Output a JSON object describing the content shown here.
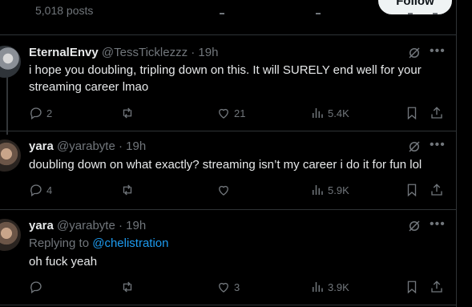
{
  "header": {
    "posts_count": "5,018 posts",
    "follow_label": "Follow"
  },
  "tweets": [
    {
      "name": "EternalEnvy",
      "handle": "@TessTicklezzz",
      "sep": "·",
      "time": "19h",
      "text": "i hope you doubling, tripling down on this. It will SURELY end well for your streaming career lmao",
      "replies": "2",
      "reposts": "",
      "likes": "21",
      "views": "5.4K"
    },
    {
      "name": "yara",
      "handle": "@yarabyte",
      "sep": "·",
      "time": "19h",
      "text": "doubling down on what exactly? streaming isn’t my career i do it for fun lol",
      "replies": "4",
      "reposts": "",
      "likes": "",
      "views": "5.9K"
    },
    {
      "name": "yara",
      "handle": "@yarabyte",
      "sep": "·",
      "time": "19h",
      "replying_prefix": "Replying to",
      "replying_to": "@chelistration",
      "text": "oh fuck yeah",
      "replies": "",
      "reposts": "",
      "likes": "3",
      "views": "3.9K"
    }
  ],
  "icons": [
    "reply-icon",
    "repost-icon",
    "like-icon",
    "views-icon",
    "bookmark-icon",
    "share-icon",
    "grok-icon",
    "more-icon"
  ],
  "colors": {
    "background": "#000000",
    "text": "#e7e9ea",
    "muted": "#71767b",
    "link": "#1d9bf0",
    "divider": "#2f3336"
  }
}
